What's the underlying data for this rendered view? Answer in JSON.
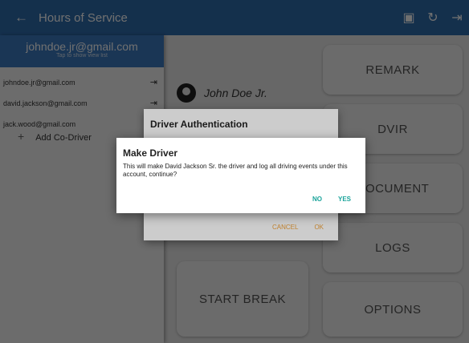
{
  "appbar": {
    "back_icon": "arrow-left-icon",
    "title": "Hours of Service",
    "actions": [
      "id-card-icon",
      "refresh-icon",
      "logout-icon"
    ]
  },
  "drawer": {
    "email": "johndoe.jr@gmail.com",
    "tap_hint": "Tap to show view list",
    "accounts": [
      {
        "email": "johndoe.jr@gmail.com",
        "icon": "logout-icon"
      },
      {
        "email": "david.jackson@gmail.com",
        "icon": "logout-icon"
      },
      {
        "email": "jack.wood@gmail.com"
      }
    ],
    "add_codriver": "Add Co-Driver"
  },
  "main": {
    "driver_name": "John Doe Jr.",
    "tiles": {
      "remark": "REMARK",
      "dvir": "DVIR",
      "document": "DOCUMENT",
      "logs": "LOGS",
      "start_break": "START BREAK",
      "options": "OPTIONS"
    }
  },
  "auth_dialog": {
    "title": "Driver Authentication",
    "cancel": "CANCEL",
    "ok": "OK"
  },
  "make_driver_dialog": {
    "title": "Make Driver",
    "message": "This will make David Jackson Sr. the driver and log all driving events under this account, continue?",
    "no": "NO",
    "yes": "YES"
  },
  "colors": {
    "appbar": "#2f6db0",
    "drawer_header": "#3d7dc3",
    "dialog_button": "#19a39a",
    "auth_button": "#f0a23a"
  }
}
